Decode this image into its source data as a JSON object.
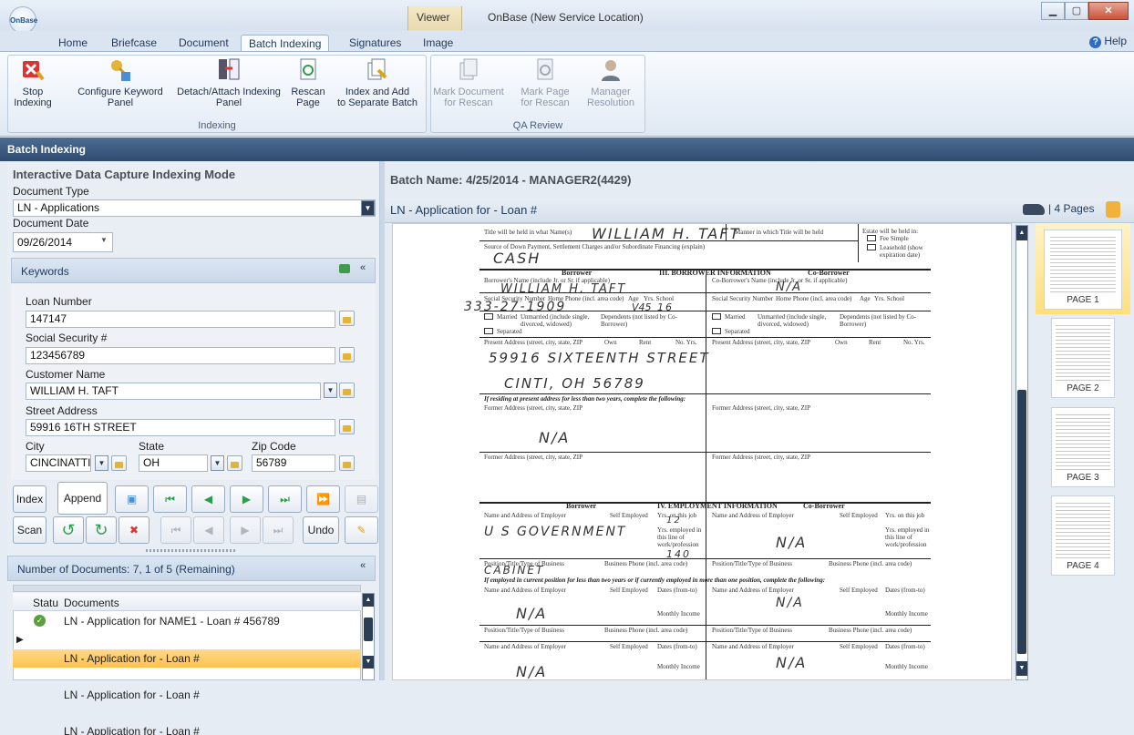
{
  "window": {
    "title": "OnBase (New Service Location)",
    "context_tab": "Viewer",
    "logo_text": "OnBase"
  },
  "ribbon_tabs": [
    "Home",
    "Briefcase",
    "Document",
    "Batch Indexing",
    "Signatures",
    "Image"
  ],
  "help_label": "Help",
  "ribbon": {
    "indexing_group": "Indexing",
    "qa_group": "QA Review",
    "buttons": {
      "stop_indexing": "Stop\nIndexing",
      "configure_keyword_panel": "Configure Keyword\nPanel",
      "detach_attach": "Detach/Attach Indexing\nPanel",
      "rescan_page": "Rescan\nPage",
      "index_add": "Index and Add\nto Separate Batch",
      "mark_doc_rescan": "Mark Document\nfor Rescan",
      "mark_page_rescan": "Mark Page\nfor Rescan",
      "manager_resolution": "Manager\nResolution"
    }
  },
  "panel_header": "Batch Indexing",
  "left": {
    "mode_title": "Interactive Data Capture Indexing Mode",
    "document_type_label": "Document Type",
    "document_type_value": "LN - Applications",
    "document_date_label": "Document Date",
    "document_date_value": "09/26/2014",
    "keywords_header": "Keywords",
    "loan_number_label": "Loan Number",
    "loan_number": "147147",
    "ssn_label": "Social Security #",
    "ssn": "123456789",
    "customer_name_label": "Customer Name",
    "customer_name": "WILLIAM H. TAFT",
    "street_label": "Street Address",
    "street": "59916 16TH STREET",
    "city_label": "City",
    "city": "CINCINATTI",
    "state_label": "State",
    "state": "OH",
    "zip_label": "Zip Code",
    "zip": "56789",
    "index_btn": "Index",
    "append_btn": "Append",
    "scan_btn": "Scan",
    "undo_btn": "Undo",
    "doc_count": "Number of Documents: 7, 1 of 5 (Remaining)",
    "col_status": "Statu",
    "col_documents": "Documents",
    "documents": [
      "LN - Application for NAME1 - Loan # 456789",
      "LN - Application for  - Loan #",
      "LN - Application for  - Loan #",
      "LN - Application for  - Loan #"
    ]
  },
  "right": {
    "batch_name": "Batch Name: 4/25/2014 - MANAGER2(4429)",
    "doc_title": "LN - Application for  - Loan #",
    "pages_label": "4 Pages",
    "thumbnails": [
      "PAGE 1",
      "PAGE 2",
      "PAGE 3",
      "PAGE 4"
    ]
  },
  "form": {
    "title_held_label": "Title will be held in what Name(s)",
    "title_held_hw": "WILLIAM H. TAFT",
    "manner_label": "Manner in which Title will be held",
    "estate_label": "Estate will be held in:",
    "fee_simple": "Fee Simple",
    "leasehold": "Leasehold (show expiration date)",
    "source_label": "Source of Down Payment, Settlement Charges and/or Subordinate Financing (explain)",
    "cash_hw": "CASH",
    "borrower": "Borrower",
    "section3": "III. BORROWER INFORMATION",
    "coborrower": "Co-Borrower",
    "borrower_name_label": "Borrower's Name (include Jr. or Sr. if applicable)",
    "coborrower_name_label": "Co-Borrower's Name (include Jr. or Sr. if applicable)",
    "borrower_name_hw": "WILLIAM H. TAFT",
    "na_hw": "N/A",
    "ssn_label": "Social Security Number",
    "home_phone_label": "Home Phone (incl. area code)",
    "age_label": "Age",
    "yrs_school_label": "Yrs. School",
    "ssn_hw": "333-27-1909",
    "age_hw": "V45",
    "yrs_school_hw": "16",
    "married": "Married",
    "unmarried": "Unmarried (include single, divorced, widowed)",
    "dependents": "Dependents (not listed by Co-Borrower)",
    "dependents_no": "no.",
    "dependents_ages": "ages",
    "separated": "Separated",
    "present_address_label": "Present Address (street, city, state, ZIP",
    "own": "Own",
    "rent": "Rent",
    "no_yrs": "No. Yrs.",
    "address1_hw": "59916 SIXTEENTH STREET",
    "address2_hw": "CINTI, OH 56789",
    "residing_note": "If residing at present address for less than two years, complete the following:",
    "former_address_label": "Former Address (street, city, state, ZIP",
    "section4": "IV. EMPLOYMENT INFORMATION",
    "employer_label": "Name and Address of Employer",
    "self_employed": "Self Employed",
    "yrs_on_job": "Yrs. on this job",
    "yrs_employed": "Yrs. employed in this line of work/profession",
    "employer_hw": "U S GOVERNMENT",
    "yrs_on_job_hw": "12",
    "yrs_employed_hw": "140",
    "position_label": "Position/Title/Type of Business",
    "business_phone": "Business Phone (incl. area code)",
    "position_hw": "CABINET",
    "employed_note": "If employed in current position for less than two years or if currently employed in more than one position, complete the following:",
    "dates": "Dates (from-to)",
    "monthly_income": "Monthly Income",
    "dollar": "$"
  }
}
